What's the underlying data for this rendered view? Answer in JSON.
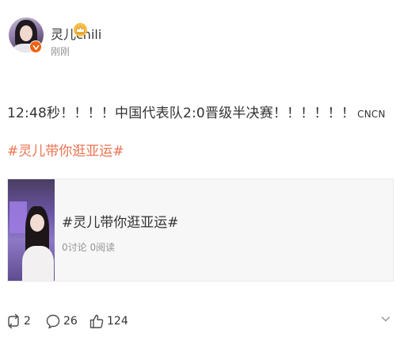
{
  "author": {
    "name": "灵儿chili",
    "avatar_icon": "user-avatar",
    "badge_icon": "verified-badge-icon",
    "crown_icon": "crown-icon",
    "time": "刚刚"
  },
  "post": {
    "text": "12:48秒！！！！中国代表队2:0晋级半决赛！！！！！！",
    "suffix": "CNCN",
    "hashtag": "#灵儿带你逛亚运#"
  },
  "card": {
    "title": "#灵儿带你逛亚运#",
    "stats": "0讨论 0阅读"
  },
  "actions": {
    "repost_count": "2",
    "comment_count": "26",
    "like_count": "124"
  },
  "colors": {
    "hashtag": "#eb7350",
    "badge": "#f1600d",
    "meta": "#939393",
    "text": "#333333"
  }
}
